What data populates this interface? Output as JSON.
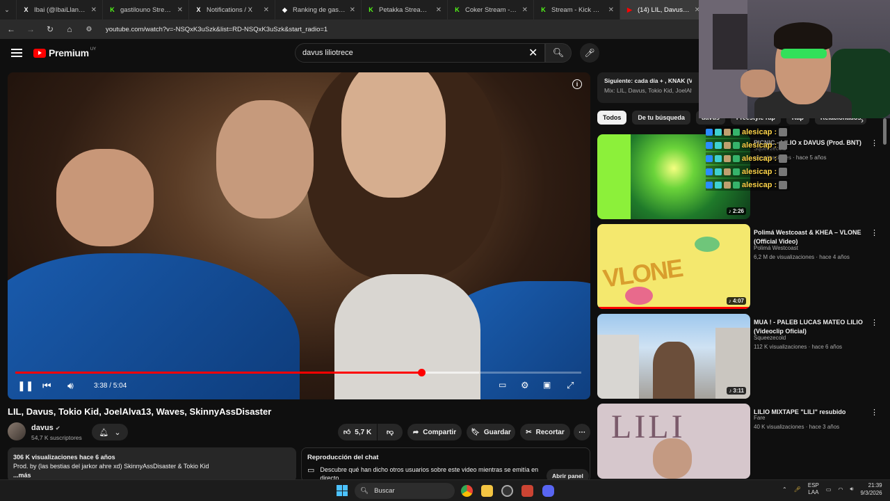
{
  "browser": {
    "tabs": [
      {
        "title": "Ibai (@IbaiLlanos) / X",
        "icon": "x-logo-icon",
        "color": "#ffffff",
        "glyph": "X"
      },
      {
        "title": "gastilouno Stream - V",
        "icon": "kick-logo-icon",
        "color": "#53fc18",
        "glyph": "K"
      },
      {
        "title": "Notifications / X",
        "icon": "x-logo-icon",
        "color": "#ffffff",
        "glyph": "X"
      },
      {
        "title": "Ranking de gastilouno",
        "icon": "diamond-icon",
        "color": "#ffffff",
        "glyph": "◆"
      },
      {
        "title": "Petakka Stream - Wa",
        "icon": "kick-logo-icon",
        "color": "#53fc18",
        "glyph": "K"
      },
      {
        "title": "Coker Stream - Watc",
        "icon": "kick-logo-icon",
        "color": "#53fc18",
        "glyph": "K"
      },
      {
        "title": "Stream - Kick Dashbo",
        "icon": "kick-logo-icon",
        "color": "#53fc18",
        "glyph": "K"
      },
      {
        "title": "(14) LIL, Davus, To",
        "icon": "youtube-logo-icon",
        "color": "#ff0000",
        "glyph": "▶"
      }
    ],
    "url": "youtube.com/watch?v=-NSQxK3uSzk&list=RD-NSQxK3uSzk&start_radio=1"
  },
  "youtube": {
    "logo_text": "Premium",
    "country": "UY",
    "search_query": "davus liliotrece"
  },
  "player": {
    "time": "3:38 / 5:04",
    "progress": 0.717,
    "buffered": 0.82
  },
  "video": {
    "title": "LIL, Davus, Tokio Kid, JoelAlva13, Waves, SkinnyAssDisaster",
    "channel": "davus",
    "subscribers": "54,7 K suscriptores",
    "likes": "5,7 K",
    "share_label": "Compartir",
    "save_label": "Guardar",
    "clip_label": "Recortar",
    "views_date": "306 K visualizaciones  hace 6 años",
    "description": "Prod. by (las bestias del jarkor ahre xd) SkinnyAssDisaster & Tokio Kid",
    "more_label": "...más"
  },
  "chat_replay": {
    "title": "Reproducción del chat",
    "text": "Descubre qué han dicho otros usuarios sobre este video mientras se emitía en directo.",
    "button": "Abrir panel"
  },
  "sidebar": {
    "next_label": "Siguiente:",
    "next_title": "cada día + , KNAK (Vi",
    "next_sub": "Mix: LIL, Davus, Tokio Kid, JoelAlva13,",
    "chips": [
      "Todos",
      "De tu búsqueda",
      "davus",
      "Freestyle rap",
      "Rap",
      "Relacionados"
    ],
    "recommendations": [
      {
        "title": "PICNIC - LILIO x DAVUS (Prod. BNT)",
        "channel": "Squeezecold",
        "meta": "visualizaciones · hace 5 años",
        "duration": "2:26"
      },
      {
        "title": "Polimá Westcoast & KHEA – VLONE (Official Video)",
        "channel": "Polimá Westcoast",
        "meta": "6,2 M de visualizaciones · hace 4 años",
        "duration": "4:07"
      },
      {
        "title": "MUA ! - PALEB LUCAS MATEO LILIO (Videoclip Oficial)",
        "channel": "Squeezecold",
        "meta": "112 K visualizaciones · hace 6 años",
        "duration": "3:11"
      },
      {
        "title": "LILIO MIXTAPE \"LILI\" resubido",
        "channel": "Fare",
        "meta": "40 K visualizaciones · hace 3 años",
        "duration": ""
      }
    ]
  },
  "stream_chat": {
    "lines": [
      {
        "user": "alesicap :"
      },
      {
        "user": "alesicap :"
      },
      {
        "user": "alesicap :"
      },
      {
        "user": "alesicap :"
      },
      {
        "user": "alesicap :"
      }
    ]
  },
  "taskbar": {
    "search_label": "Buscar",
    "lang": "ESP",
    "layout": "LAA",
    "time": "21:39",
    "date": "9/3/2026"
  }
}
